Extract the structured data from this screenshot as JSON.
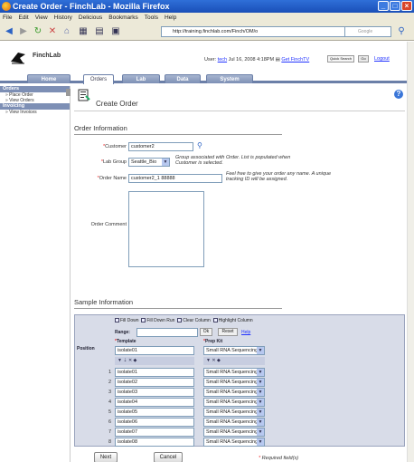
{
  "window": {
    "title": "Create Order - FinchLab - Mozilla Firefox",
    "buttons": [
      "_",
      "□",
      "×"
    ]
  },
  "menu": [
    "File",
    "Edit",
    "View",
    "History",
    "Delicious",
    "Bookmarks",
    "Tools",
    "Help"
  ],
  "nav": {
    "url": "http://training.finchlab.com/Finch/OM/o",
    "search_placeholder": "Google"
  },
  "app": {
    "name": "FinchLab",
    "user_label": "User:",
    "user": "tech",
    "datetime": "Jul 16, 2008 4:18PM",
    "finchtv": "Get FinchTV",
    "quick_search": "Quick Search",
    "go": "Go",
    "logout": "Logout"
  },
  "tabs": [
    {
      "label": "Home",
      "active": false
    },
    {
      "label": "Orders",
      "active": true
    },
    {
      "label": "Lab",
      "active": false
    },
    {
      "label": "Data",
      "active": false
    },
    {
      "label": "System",
      "active": false
    }
  ],
  "sidebar": [
    {
      "title": "Orders",
      "items": [
        "Place Order",
        "View Orders"
      ]
    },
    {
      "title": "Invoicing",
      "items": [
        "View Invoices"
      ]
    }
  ],
  "page": {
    "title": "Create Order"
  },
  "order_info": {
    "section": "Order Information",
    "customer_label": "Customer",
    "customer_value": "customer2",
    "labgroup_label": "Lab Group",
    "labgroup_value": "Seattle_Bio",
    "labgroup_note": "Group associated with Order. List is populated when Customer is selected.",
    "ordername_label": "Order Name",
    "ordername_value": "customer2_1 88888",
    "ordername_note": "Feel free to give your order any name. A unique tracking ID will be assigned.",
    "comment_label": "Order Comment"
  },
  "sample_info": {
    "section": "Sample Information",
    "toolbar": [
      "Fill Down",
      "Fill Down Run",
      "Clear Column",
      "Highlight Column"
    ],
    "range_label": "Range:",
    "ok": "Ok",
    "reset": "Reset",
    "help": "Help",
    "col_position": "Position",
    "col_template": "Template",
    "col_prepkit": "Prep Kit",
    "top_template": "isolate01",
    "top_prepkit": "Small RNA Sequencing",
    "rows": [
      {
        "pos": "1",
        "template": "isolate01",
        "kit": "Small RNA Sequencing"
      },
      {
        "pos": "2",
        "template": "isolate02",
        "kit": "Small RNA Sequencing"
      },
      {
        "pos": "3",
        "template": "isolate03",
        "kit": "Small RNA Sequencing"
      },
      {
        "pos": "4",
        "template": "isolate04",
        "kit": "Small RNA Sequencing"
      },
      {
        "pos": "5",
        "template": "isolate05",
        "kit": "Small RNA Sequencing"
      },
      {
        "pos": "6",
        "template": "isolate06",
        "kit": "Small RNA Sequencing"
      },
      {
        "pos": "7",
        "template": "isolate07",
        "kit": "Small RNA Sequencing"
      },
      {
        "pos": "8",
        "template": "isolate08",
        "kit": "Small RNA Sequencing"
      }
    ]
  },
  "footer": {
    "next": "Next",
    "cancel": "Cancel",
    "required": "Required field(s)"
  }
}
